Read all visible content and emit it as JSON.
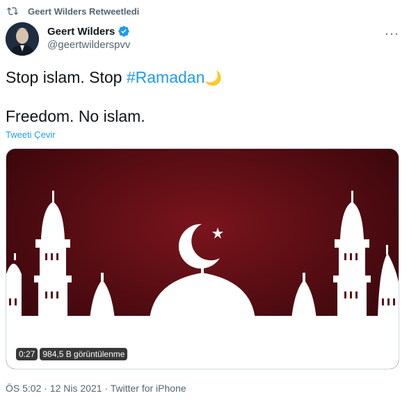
{
  "retweet": {
    "label": "Geert Wilders Retweetledi",
    "icon": "retweet-icon"
  },
  "author": {
    "name": "Geert Wilders",
    "handle": "@geertwilderspvv",
    "verified_color": "#1d9bf0"
  },
  "tweet": {
    "line1_prefix": "Stop islam. Stop ",
    "hashtag": "#Ramadan",
    "emoji": "🌙",
    "line2": "Freedom. No islam.",
    "translate": "Tweeti Çevir"
  },
  "media": {
    "duration": "0:27",
    "views": "984,5 B görüntülenme",
    "colors": {
      "dark": "#3a070b",
      "mid": "#6e1118",
      "white": "#ffffff"
    }
  },
  "meta": {
    "timestamp": "ÖS 5:02 · 12 Nis 2021 · Twitter for iPhone"
  }
}
